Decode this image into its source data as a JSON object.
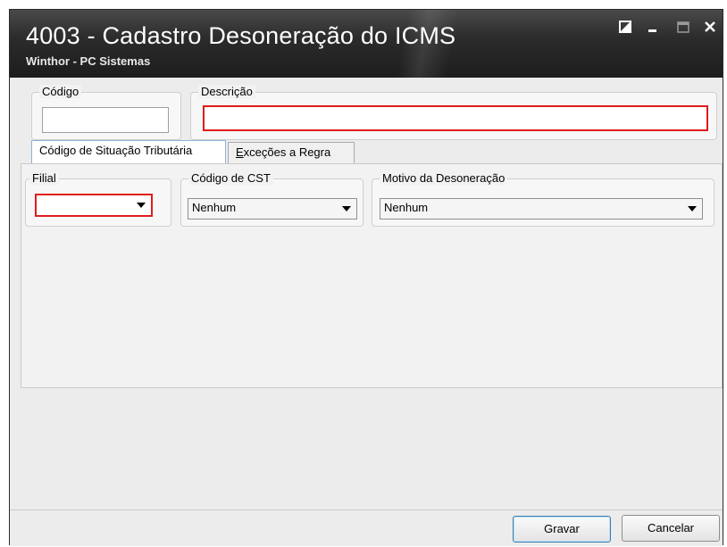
{
  "window": {
    "title": "4003 - Cadastro Desoneração do ICMS",
    "subtitle": "Winthor - PC Sistemas"
  },
  "header": {
    "codigo_label": "Código",
    "codigo_value": "",
    "descricao_label": "Descrição",
    "descricao_value": ""
  },
  "tabs": [
    {
      "label": "Código de Situação Tributária",
      "active": true
    },
    {
      "label_underlined": "E",
      "label_rest": "xceções a Regra",
      "active": false
    }
  ],
  "panel": {
    "filial_label": "Filial",
    "filial_value": "",
    "cst_label": "Código de CST",
    "cst_value": "Nenhum",
    "motivo_label": "Motivo da Desoneração",
    "motivo_value": "Nenhum"
  },
  "footer": {
    "save_label": "Gravar",
    "cancel_label": "Cancelar"
  },
  "colors": {
    "highlight": "#e21b1b",
    "titlebar": "#2c2c2c"
  }
}
